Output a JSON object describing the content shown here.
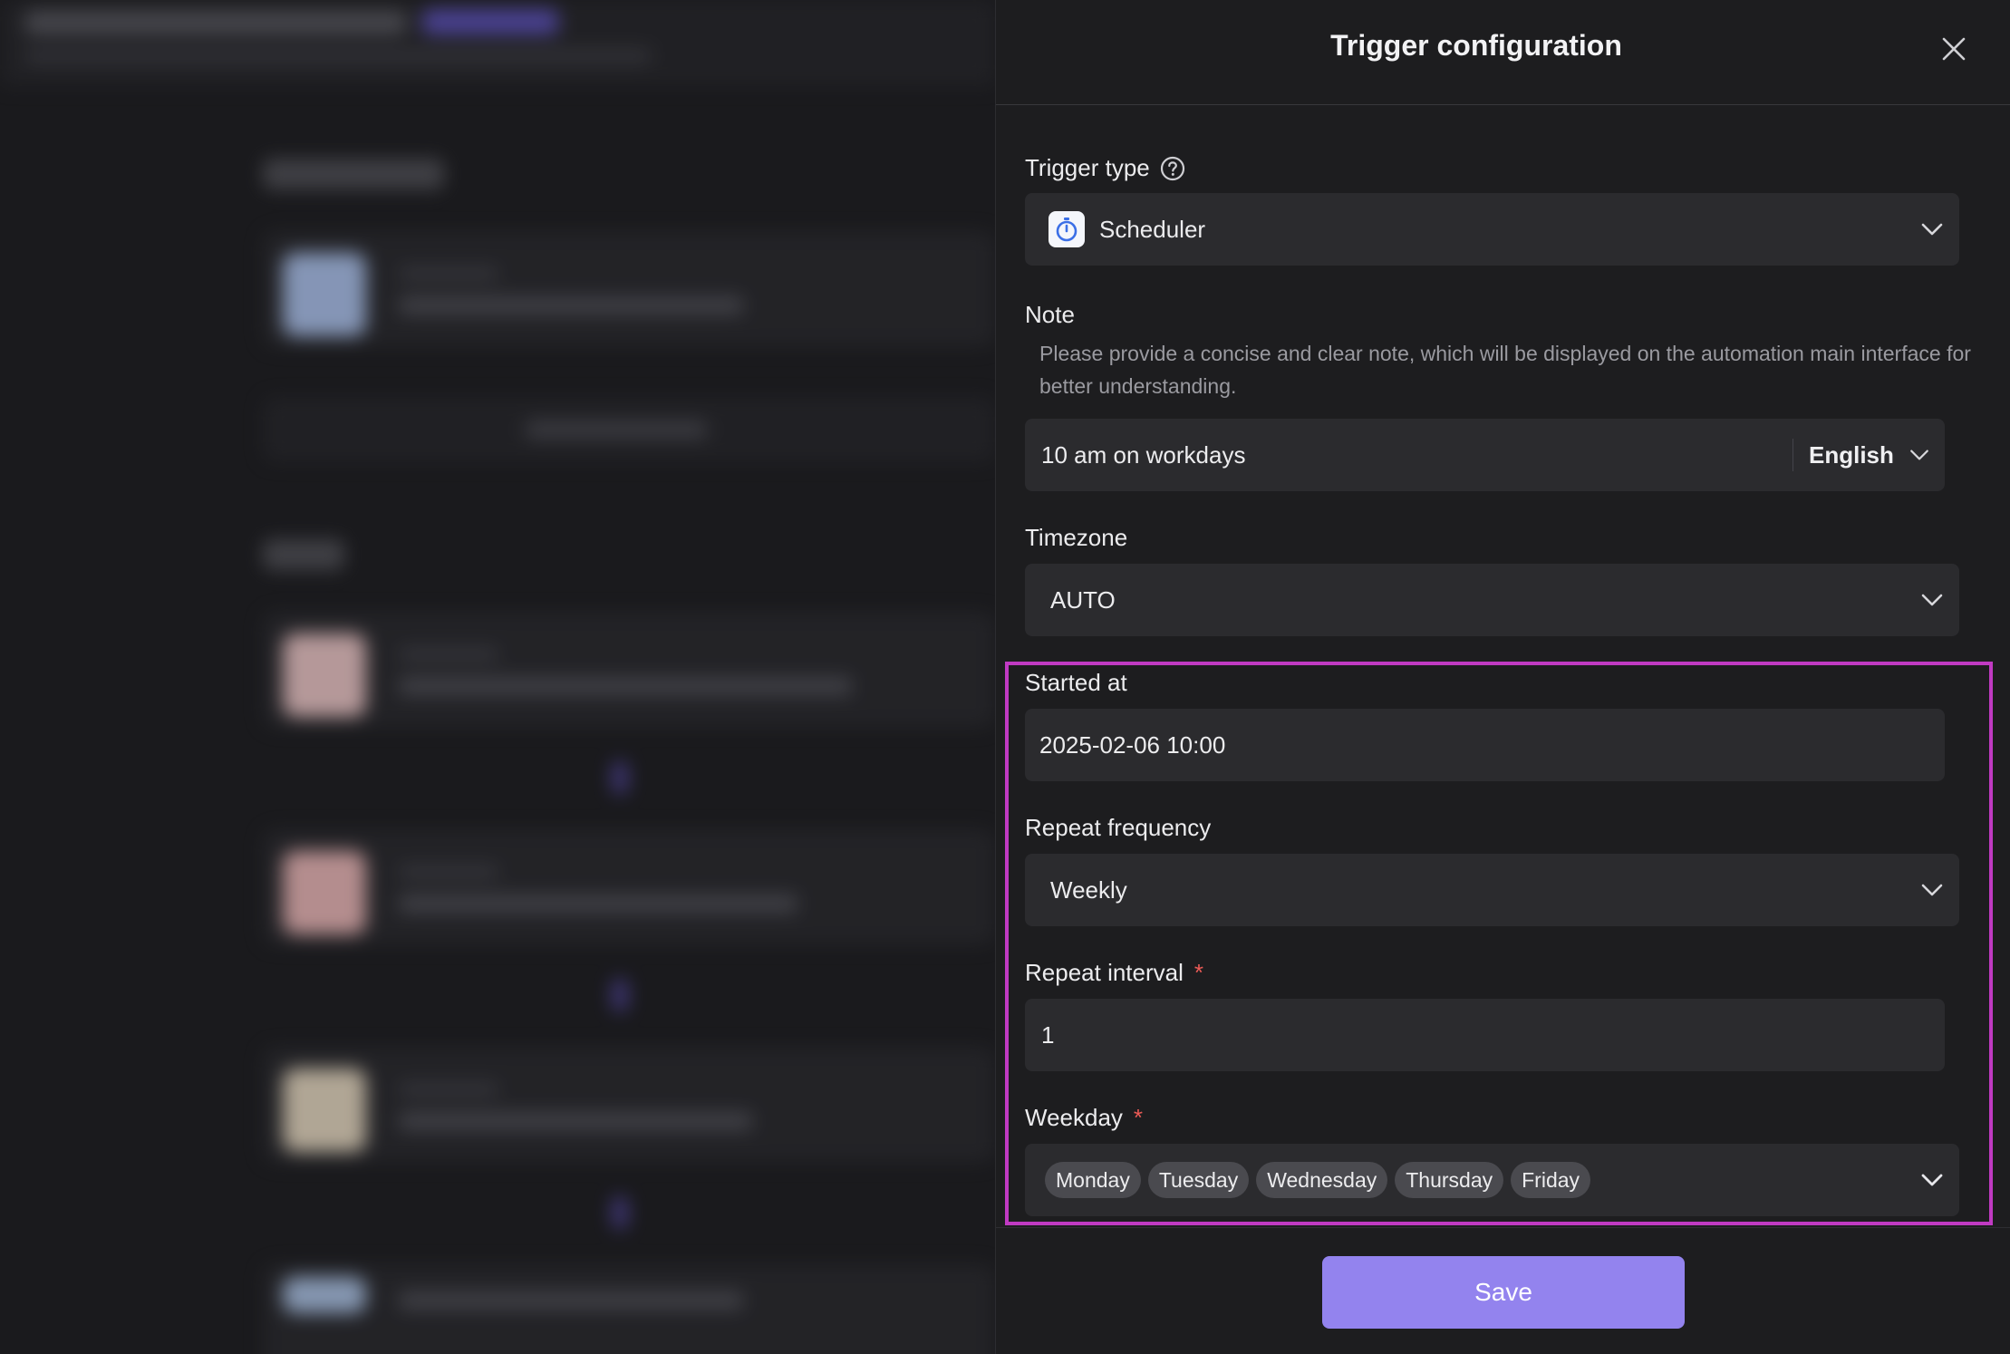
{
  "drawer": {
    "title": "Trigger configuration",
    "close_icon": "close-icon"
  },
  "trigger_type": {
    "label": "Trigger type",
    "help_icon": "question-circle-icon",
    "value": "Scheduler",
    "icon": "stopwatch-icon"
  },
  "note": {
    "label": "Note",
    "help_text": "Please provide a concise and clear note, which will be displayed on the automation main interface for better understanding.",
    "value": "10 am on workdays",
    "language": "English"
  },
  "timezone": {
    "label": "Timezone",
    "value": "AUTO"
  },
  "started_at": {
    "label": "Started at",
    "value": "2025-02-06 10:00"
  },
  "repeat_frequency": {
    "label": "Repeat frequency",
    "value": "Weekly"
  },
  "repeat_interval": {
    "label": "Repeat interval",
    "required_mark": "*",
    "value": "1"
  },
  "weekday": {
    "label": "Weekday",
    "required_mark": "*",
    "selected": [
      "Monday",
      "Tuesday",
      "Wednesday",
      "Thursday",
      "Friday"
    ]
  },
  "footer": {
    "save_label": "Save"
  },
  "colors": {
    "accent": "#9383ee",
    "highlight": "#c03ac2",
    "required": "#ec5b56",
    "panel": "#1d1d1f",
    "input": "#2b2b2e"
  }
}
